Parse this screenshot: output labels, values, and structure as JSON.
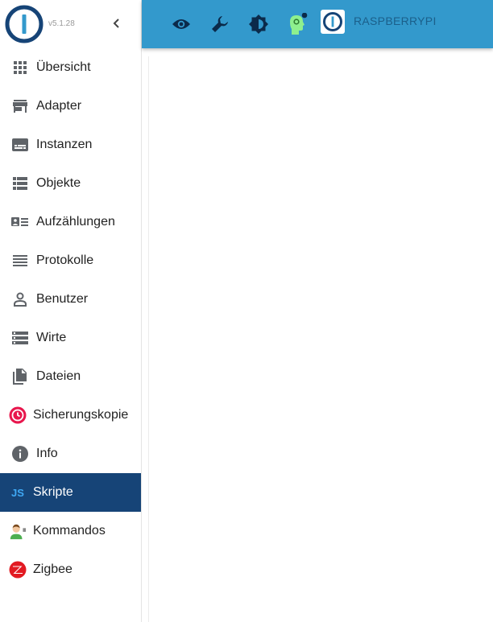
{
  "app": {
    "version": "v5.1.28",
    "host": "RASPBERRYPI",
    "colors": {
      "toolbar": "#3399cc",
      "active_item": "#164477",
      "icon": "#5f6368",
      "status_dot": "#0b2a4a"
    }
  },
  "toolbar": {
    "icons": [
      "eye-icon",
      "wrench-icon",
      "brightness-icon",
      "expert-head-icon"
    ]
  },
  "sidebar": {
    "collapse_icon": "chevron-left-icon",
    "items": [
      {
        "label": "Übersicht",
        "icon": "grid-icon"
      },
      {
        "label": "Adapter",
        "icon": "store-icon"
      },
      {
        "label": "Instanzen",
        "icon": "instances-icon"
      },
      {
        "label": "Objekte",
        "icon": "list-icon"
      },
      {
        "label": "Aufzählungen",
        "icon": "enums-icon"
      },
      {
        "label": "Protokolle",
        "icon": "lines-icon"
      },
      {
        "label": "Benutzer",
        "icon": "user-icon"
      },
      {
        "label": "Wirte",
        "icon": "hosts-icon"
      },
      {
        "label": "Dateien",
        "icon": "files-icon"
      },
      {
        "label": "Sicherungskopie",
        "icon": "backup-clock-icon"
      },
      {
        "label": "Info",
        "icon": "info-icon"
      },
      {
        "label": "Skripte",
        "icon": "js-icon",
        "active": true
      },
      {
        "label": "Kommandos",
        "icon": "person-command-icon"
      },
      {
        "label": "Zigbee",
        "icon": "zigbee-icon"
      }
    ]
  }
}
